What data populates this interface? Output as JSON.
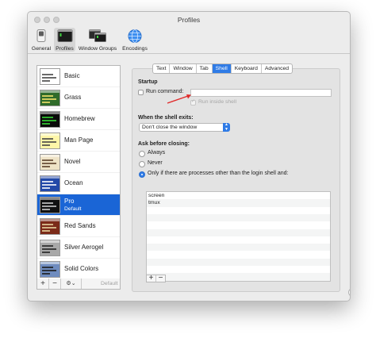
{
  "window": {
    "title": "Profiles"
  },
  "toolbar": {
    "items": [
      {
        "label": "General",
        "icon": "switch-icon"
      },
      {
        "label": "Profiles",
        "icon": "terminal-icon",
        "selected": true
      },
      {
        "label": "Window Groups",
        "icon": "window-groups-icon"
      },
      {
        "label": "Encodings",
        "icon": "globe-icon"
      }
    ]
  },
  "profiles": [
    {
      "name": "Basic",
      "bg": "#ffffff",
      "fg": "#444444"
    },
    {
      "name": "Grass",
      "bg": "#2f6b2a",
      "fg": "#f5e36b"
    },
    {
      "name": "Homebrew",
      "bg": "#0a0a0a",
      "fg": "#35d435"
    },
    {
      "name": "Man Page",
      "bg": "#fdf6a8",
      "fg": "#444444"
    },
    {
      "name": "Novel",
      "bg": "#eee3c6",
      "fg": "#5a3e28"
    },
    {
      "name": "Ocean",
      "bg": "#2249a8",
      "fg": "#ffffff"
    },
    {
      "name": "Pro",
      "sub": "Default",
      "bg": "#111111",
      "fg": "#cccccc",
      "selected": true
    },
    {
      "name": "Red Sands",
      "bg": "#7b2a18",
      "fg": "#e8d6a0"
    },
    {
      "name": "Silver Aerogel",
      "bg": "#a8a8a8",
      "fg": "#222222"
    },
    {
      "name": "Solid Colors",
      "bg": "#6f8cbf",
      "fg": "#1a1a1a"
    }
  ],
  "list_footer": {
    "add": "+",
    "remove": "−",
    "gear": "⚙︎⌄",
    "default": "Default"
  },
  "tabs": [
    {
      "label": "Text"
    },
    {
      "label": "Window"
    },
    {
      "label": "Tab"
    },
    {
      "label": "Shell",
      "active": true
    },
    {
      "label": "Keyboard"
    },
    {
      "label": "Advanced"
    }
  ],
  "startup": {
    "title": "Startup",
    "run_command_label": "Run command:",
    "run_command_value": "",
    "run_inside_shell_label": "Run inside shell"
  },
  "shell_exit": {
    "title": "When the shell exits:",
    "selected": "Don't close the window"
  },
  "ask_close": {
    "title": "Ask before closing:",
    "options": [
      {
        "label": "Always",
        "selected": false
      },
      {
        "label": "Never",
        "selected": false
      },
      {
        "label": "Only if there are processes other than the login shell and:",
        "selected": true
      }
    ],
    "processes": [
      "screen",
      "tmux"
    ]
  },
  "process_buttons": {
    "add": "+",
    "remove": "−"
  },
  "help": "?",
  "colors": {
    "accent": "#2f7be6",
    "selection": "#1a65d6",
    "annotation_arrow": "#e02a2a"
  }
}
